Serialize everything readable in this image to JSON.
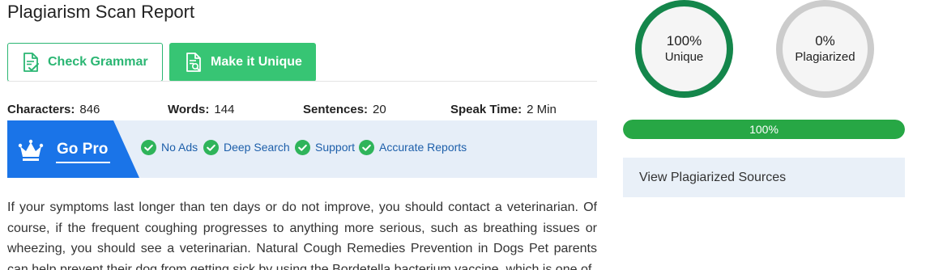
{
  "report": {
    "title": "Plagiarism Scan Report"
  },
  "actions": {
    "check_grammar_label": "Check Grammar",
    "make_unique_label": "Make it Unique"
  },
  "stats": {
    "characters_label": "Characters:",
    "characters_value": "846",
    "words_label": "Words:",
    "words_value": "144",
    "sentences_label": "Sentences:",
    "sentences_value": "20",
    "speak_time_label": "Speak Time:",
    "speak_time_value": "2 Min"
  },
  "promo": {
    "title": "Go Pro",
    "features": [
      "No Ads",
      "Deep Search",
      "Support",
      "Accurate Reports"
    ]
  },
  "content": {
    "text": "If your symptoms last longer than ten days or do not improve, you should contact a veterinarian. Of course, if the frequent coughing progresses to anything more serious, such as breathing issues or wheezing, you should see a veterinarian. Natural Cough Remedies Prevention in Dogs Pet parents can help prevent their dog from getting sick by using the Bordetella bacterium vaccine, which is one of"
  },
  "results": {
    "unique_percent": "100%",
    "unique_label": "Unique",
    "plagiarized_percent": "0%",
    "plagiarized_label": "Plagiarized",
    "progress_value": 100,
    "progress_label": "100%",
    "view_sources_label": "View Plagiarized Sources"
  },
  "colors": {
    "brand_green": "#37c574",
    "unique_ring": "#14864b",
    "plagiarized_ring": "#cccccc",
    "progress_fill": "#27a745",
    "promo_blue": "#1a74e8",
    "feature_text": "#1d5faa"
  },
  "icons": {
    "check_grammar": "document-check-icon",
    "make_unique": "document-search-icon",
    "go_pro": "crown-icon",
    "feature": "check-circle-icon"
  }
}
